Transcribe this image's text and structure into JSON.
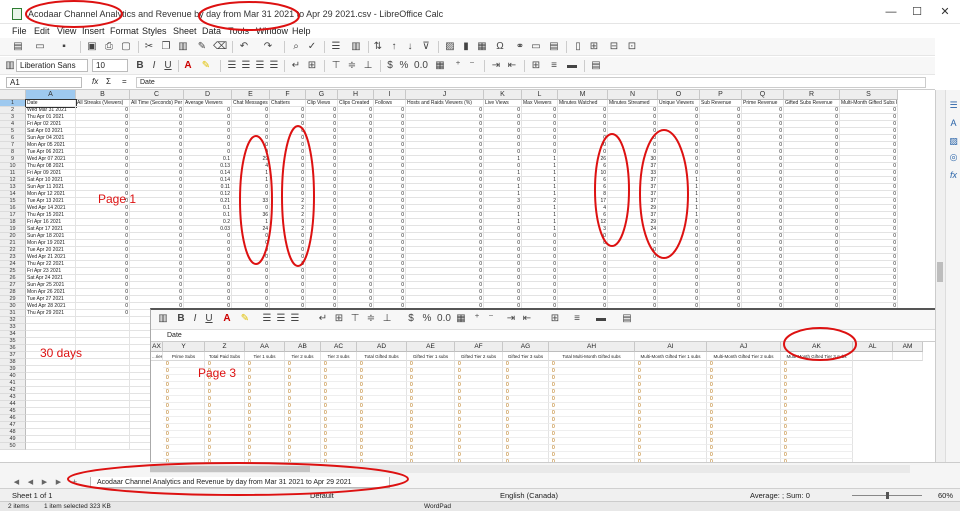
{
  "window": {
    "title": "Acodaar Channel Analytics and Revenue by day from Mar 31 2021 to Apr 29 2021.csv - LibreOffice Calc",
    "minimize": "—",
    "maximize": "☐",
    "close": "✕"
  },
  "menu": [
    "File",
    "Edit",
    "View",
    "Insert",
    "Format",
    "Styles",
    "Sheet",
    "Data",
    "Tools",
    "Window",
    "Help"
  ],
  "format_bar": {
    "font_name": "Liberation Sans",
    "font_size": "10",
    "bold": "B",
    "italic": "I",
    "underline": "U",
    "percent": "%",
    "decimal": "0.0"
  },
  "formula_bar": {
    "name_box": "A1",
    "fx": "fx",
    "sum": "Σ",
    "equals": "=",
    "content": "Date"
  },
  "grid": {
    "columns": [
      "A",
      "B",
      "C",
      "D",
      "E",
      "F",
      "G",
      "H",
      "I",
      "J",
      "K",
      "L",
      "M",
      "N",
      "O",
      "P",
      "Q",
      "R",
      "S"
    ],
    "header_row": [
      "Date",
      "All Streaks (Viewers)",
      "All Time (Seconds) Per User",
      "Average Viewers",
      "Chat Messages",
      "Chatters",
      "Clip Views",
      "Clips Created",
      "Follows",
      "Hosts and Raids Viewers (%)",
      "Live Views",
      "Max Viewers",
      "Minutes Watched",
      "Minutes Streamed",
      "Unique Viewers",
      "Sub Revenue",
      "Prime Revenue",
      "Gifted Subs Revenue",
      "Multi-Month Gifted Subs Rev"
    ],
    "row_numbers": [
      "1",
      "2",
      "3",
      "4",
      "5",
      "6",
      "7",
      "8",
      "9",
      "10",
      "11",
      "12",
      "13",
      "14",
      "15",
      "16",
      "17",
      "18",
      "19",
      "20",
      "21",
      "22",
      "23",
      "24",
      "25",
      "26",
      "27",
      "28",
      "29",
      "30",
      "31",
      "32",
      "33",
      "34",
      "35",
      "36",
      "37",
      "38",
      "39",
      "40",
      "41",
      "42",
      "43",
      "44",
      "45",
      "46",
      "47",
      "48",
      "49",
      "50"
    ],
    "dates": [
      "Wed Mar 31 2021",
      "Thu Apr 01 2021",
      "Fri Apr 02 2021",
      "Sat Apr 03 2021",
      "Sun Apr 04 2021",
      "Mon Apr 05 2021",
      "Tue Apr 06 2021",
      "Wed Apr 07 2021",
      "Thu Apr 08 2021",
      "Fri Apr 09 2021",
      "Sat Apr 10 2021",
      "Sun Apr 11 2021",
      "Mon Apr 12 2021",
      "Tue Apr 13 2021",
      "Wed Apr 14 2021",
      "Thu Apr 15 2021",
      "Fri Apr 16 2021",
      "Sat Apr 17 2021",
      "Sun Apr 18 2021",
      "Mon Apr 19 2021",
      "Tue Apr 20 2021",
      "Wed Apr 21 2021",
      "Thu Apr 22 2021",
      "Fri Apr 23 2021",
      "Sat Apr 24 2021",
      "Sun Apr 25 2021",
      "Mon Apr 26 2021",
      "Tue Apr 27 2021",
      "Wed Apr 28 2021",
      "Thu Apr 29 2021"
    ],
    "avg_viewers": [
      "0",
      "0",
      "0",
      "0",
      "0",
      "0",
      "0",
      "0.1",
      "0.13",
      "0.14",
      "0.14",
      "0.11",
      "0.12",
      "0.21",
      "0.1",
      "0.1",
      "0.2",
      "0.03",
      "0",
      "0",
      "0",
      "0",
      "0",
      "0",
      "0",
      "0",
      "0",
      "0",
      "0",
      "0"
    ],
    "chat_messages": [
      "0",
      "0",
      "0",
      "0",
      "0",
      "0",
      "0",
      "29",
      "4",
      "1",
      "1",
      "0",
      "0",
      "33",
      "0",
      "36",
      "1",
      "24",
      "0",
      "0",
      "0",
      "0",
      "0",
      "0",
      "0",
      "0",
      "0",
      "0",
      "0",
      "0"
    ],
    "chatters": [
      "0",
      "0",
      "0",
      "0",
      "0",
      "0",
      "0",
      "0",
      "0",
      "0",
      "0",
      "0",
      "0",
      "2",
      "2",
      "2",
      "0",
      "2",
      "0",
      "0",
      "0",
      "0",
      "0",
      "0",
      "0",
      "0",
      "0",
      "0",
      "0",
      "0"
    ],
    "live_views": [
      "0",
      "0",
      "0",
      "0",
      "0",
      "0",
      "0",
      "1",
      "0",
      "1",
      "0",
      "1",
      "1",
      "3",
      "0",
      "1",
      "1",
      "0",
      "0",
      "0",
      "0",
      "0",
      "0",
      "0",
      "0",
      "0",
      "0",
      "0",
      "0",
      "0"
    ],
    "max_viewers": [
      "0",
      "0",
      "0",
      "0",
      "0",
      "0",
      "0",
      "1",
      "1",
      "1",
      "1",
      "1",
      "1",
      "2",
      "1",
      "1",
      "1",
      "1",
      "0",
      "0",
      "0",
      "0",
      "0",
      "0",
      "0",
      "0",
      "0",
      "0",
      "0",
      "0"
    ],
    "minutes_watched": [
      "0",
      "0",
      "0",
      "0",
      "0",
      "0",
      "0",
      "26",
      "6",
      "10",
      "6",
      "6",
      "8",
      "17",
      "4",
      "6",
      "12",
      "3",
      "0",
      "0",
      "0",
      "0",
      "0",
      "0",
      "0",
      "0",
      "0",
      "0",
      "0",
      "0"
    ],
    "minutes_streamed": [
      "0",
      "0",
      "0",
      "0",
      "0",
      "0",
      "0",
      "30",
      "37",
      "33",
      "37",
      "37",
      "37",
      "37",
      "29",
      "37",
      "29",
      "24",
      "0",
      "0",
      "0",
      "0",
      "0",
      "0",
      "0",
      "0",
      "0",
      "0",
      "0",
      "0"
    ],
    "unique_viewers": [
      "0",
      "0",
      "0",
      "0",
      "0",
      "0",
      "0",
      "0",
      "0",
      "0",
      "1",
      "1",
      "1",
      "1",
      "1",
      "1",
      "0",
      "0",
      "0",
      "0",
      "0",
      "0",
      "0",
      "0",
      "0",
      "0",
      "0",
      "0",
      "0",
      "0"
    ]
  },
  "overlay": {
    "formula_content": "Date",
    "columns": [
      "AX",
      "Y",
      "Z",
      "AA",
      "AB",
      "AC",
      "AD",
      "AE",
      "AF",
      "AG",
      "AH",
      "AI",
      "AJ",
      "AK",
      "AL",
      "AM"
    ],
    "headers": [
      "...ries",
      "Prime Subs",
      "Total Paid Subs",
      "Tier 1 subs",
      "Tier 2 subs",
      "Tier 3 subs",
      "Total Gifted Subs",
      "Gifted Tier 1 subs",
      "Gifted Tier 2 subs",
      "Gifted Tier 3 subs",
      "Total Multi-Month Gifted subs",
      "Multi-Month Gifted Tier 1 subs",
      "Multi-Month Gifted Tier 2 subs",
      "Multi-Month Gifted Tier 3 subs",
      "",
      ""
    ],
    "rows_shown": 15
  },
  "annotations": {
    "page1": "Page 1",
    "page3": "Page 3",
    "days": "30 days"
  },
  "tabs": {
    "sheet_name": "Acodaar Channel Analytics and Revenue by day from Mar 31 2021 to Apr 29 2021"
  },
  "status": {
    "sheet": "Sheet 1 of 1",
    "style": "Default",
    "language": "English (Canada)",
    "summary": "Average: ; Sum: 0",
    "zoom": "60%"
  },
  "taskbar": {
    "items": "2 items",
    "selected": "1 item selected  323 KB",
    "app": "WordPad"
  }
}
